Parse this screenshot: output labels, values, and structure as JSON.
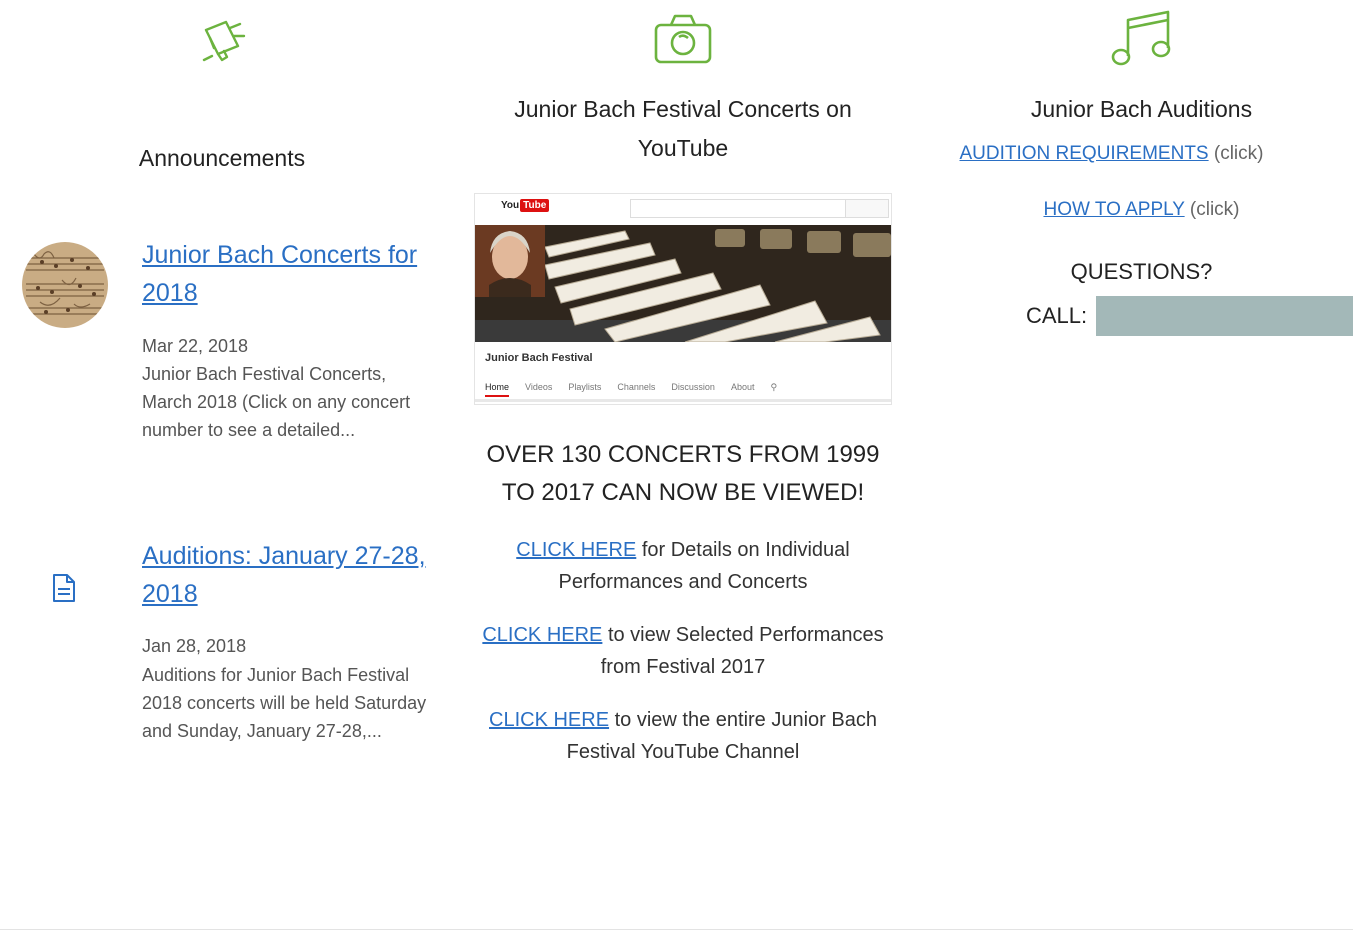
{
  "announcements": {
    "heading": "Announcements",
    "icon": "megaphone-icon",
    "items": [
      {
        "title": "Junior Bach Concerts for 2018",
        "date": "Mar 22, 2018",
        "snippet": "Junior Bach Festival Concerts, March 2018 (Click on any concert number to see a detailed...",
        "thumb": "manuscript-thumbnail"
      },
      {
        "title": "Auditions: January 27-28, 2018",
        "date": "Jan 28, 2018",
        "snippet": "Auditions for Junior Bach Festival 2018 concerts will be held Saturday and Sunday, January 27-28,...",
        "thumb": "document-icon"
      }
    ]
  },
  "youtube": {
    "heading": "Junior Bach Festival Concerts on YouTube",
    "icon": "camera-icon",
    "screenshot": {
      "logo_you": "You",
      "logo_tube": "Tube",
      "channel_name": "Junior Bach Festival",
      "tabs": [
        "Home",
        "Videos",
        "Playlists",
        "Channels",
        "Discussion",
        "About"
      ]
    },
    "headline": "OVER 130 CONCERTS FROM 1999 TO 2017 CAN NOW BE VIEWED!",
    "links": [
      {
        "link": "CLICK HERE",
        "text": " for Details on Individual Performances and Concerts"
      },
      {
        "link": "CLICK HERE",
        "text": " to view Selected Performances from Festival 2017"
      },
      {
        "link": "CLICK HERE",
        "text": " to view the entire Junior Bach Festival YouTube Channel"
      }
    ]
  },
  "auditions": {
    "heading": "Junior Bach Auditions",
    "icon": "music-note-icon",
    "requirements_link": "AUDITION REQUIREMENTS",
    "requirements_suffix": " (click)",
    "apply_link": "HOW TO APPLY",
    "apply_suffix": " (click)",
    "questions": "QUESTIONS?",
    "call_label": "CALL:"
  },
  "colors": {
    "icon_green": "#6cb33f",
    "link_blue": "#2a6fc4",
    "redaction": "#a3b8b8"
  }
}
